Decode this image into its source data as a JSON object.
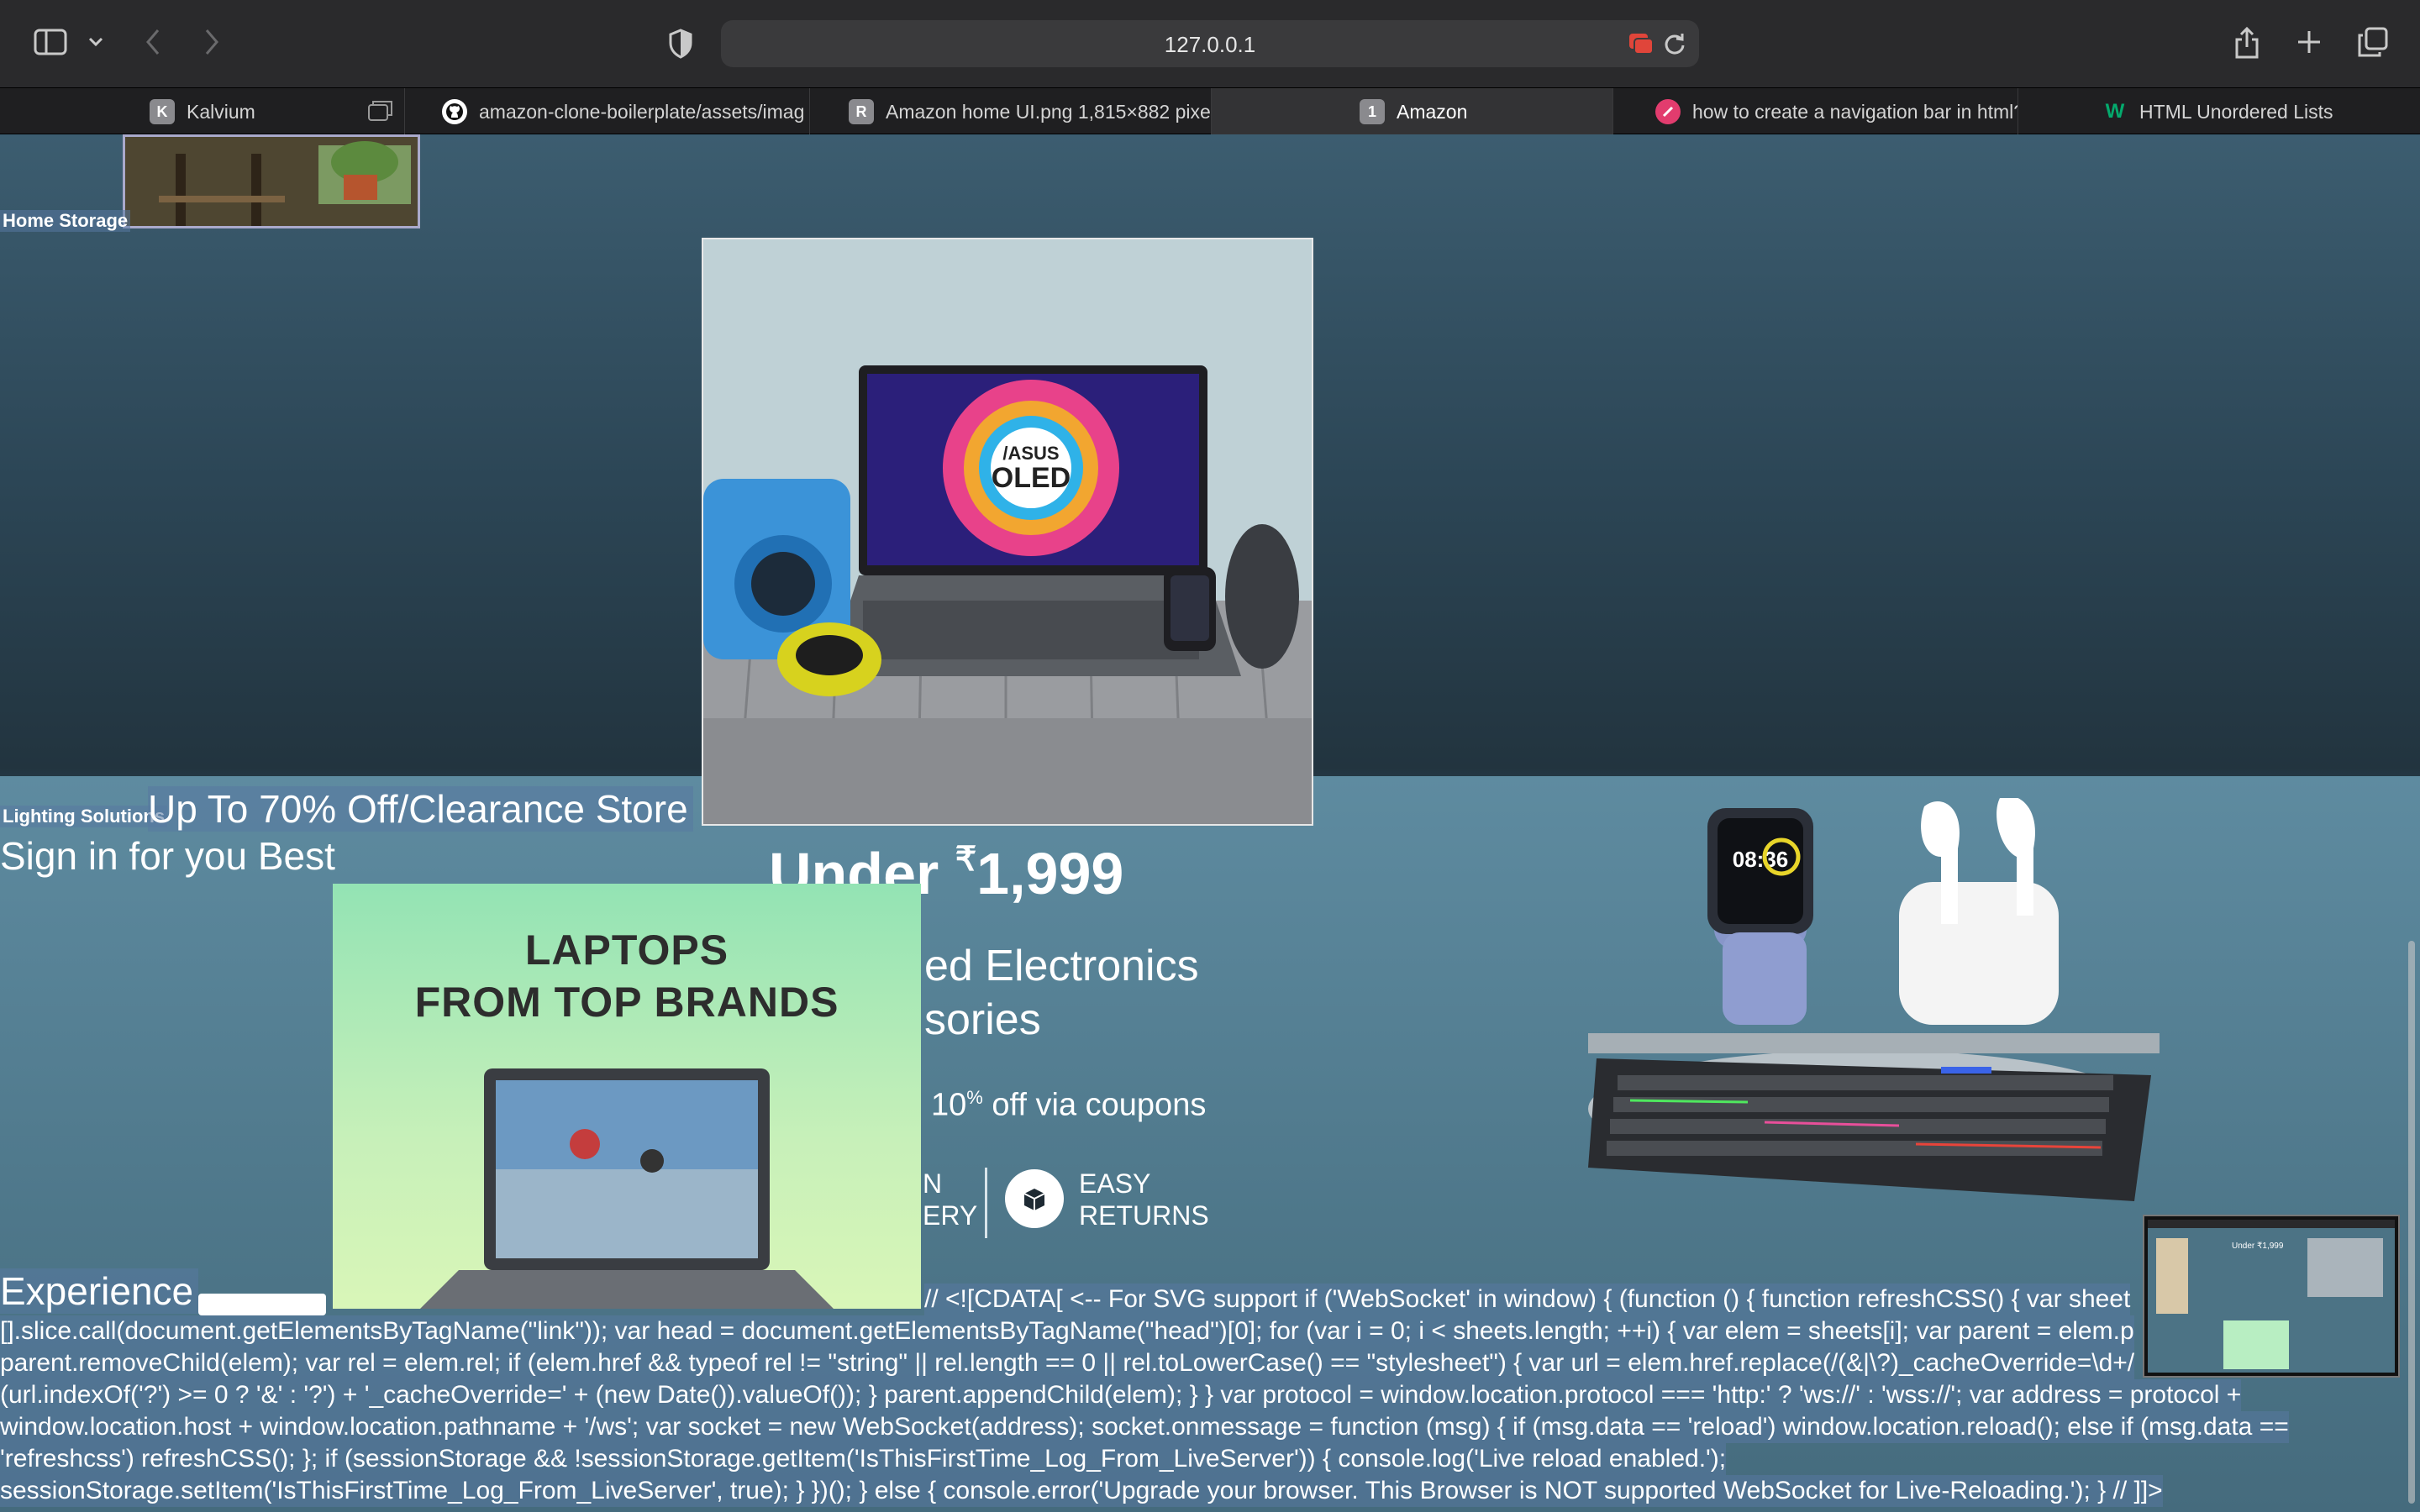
{
  "browser": {
    "url": "127.0.0.1",
    "tabs": [
      {
        "title": "Kalvium",
        "favicon": "K"
      },
      {
        "title": "amazon-clone-boilerplate/assets/imag",
        "favicon": ""
      },
      {
        "title": "Amazon home UI.png 1,815×882 pixe",
        "favicon": "R"
      },
      {
        "title": "Amazon",
        "favicon": "1"
      },
      {
        "title": "how to create a navigation bar in html?",
        "favicon": ""
      },
      {
        "title": "HTML Unordered Lists",
        "favicon": "W"
      }
    ]
  },
  "page": {
    "home_storage": "Home Storage",
    "lighting_solutions": "Lighting Solutions",
    "clearance": "Up To 70% Off/Clearance Store",
    "sign_in": "Sign in for you Best",
    "experience": "Experience",
    "laptops_line1": "LAPTOPS",
    "laptops_line2": "FROM TOP BRANDS",
    "hero_brand": "/ASUS",
    "hero_badge": "OLED",
    "banner_price_prefix": "Under",
    "banner_price_currency": "₹",
    "banner_price": "1,999",
    "banner_line1": "ed Electronics",
    "banner_line2": "sories",
    "banner_coupon_pre": "10",
    "banner_coupon_sup": "%",
    "banner_coupon_post": " off via coupons",
    "banner_delivery_1": "N",
    "banner_delivery_2": "ERY",
    "banner_returns_1": "EASY",
    "banner_returns_2": "RETURNS",
    "watch_time": "08:36",
    "code_lines": [
      "// <![CDATA[ <-- For SVG support if ('WebSocket' in window) { (function () { function refreshCSS() { var sheet",
      "[].slice.call(document.getElementsByTagName(\"link\")); var head = document.getElementsByTagName(\"head\")[0]; for (var i = 0; i < sheets.length; ++i) { var elem = sheets[i]; var parent = elem.p",
      "parent.removeChild(elem); var rel = elem.rel; if (elem.href && typeof rel != \"string\" || rel.length == 0 || rel.toLowerCase() == \"stylesheet\") { var url = elem.href.replace(/(&|\\?)_cacheOverride=\\d+/",
      "(url.indexOf('?') >= 0 ? '&' : '?') + '_cacheOverride=' + (new Date()).valueOf()); } parent.appendChild(elem); } } var protocol = window.location.protocol === 'http:' ? 'ws://' : 'wss://'; var address = protocol +",
      "window.location.host + window.location.pathname + '/ws'; var socket = new WebSocket(address); socket.onmessage = function (msg) { if (msg.data == 'reload') window.location.reload(); else if (msg.data ==",
      "'refreshcss') refreshCSS(); }; if (sessionStorage && !sessionStorage.getItem('IsThisFirstTime_Log_From_LiveServer')) { console.log('Live reload enabled.');",
      "sessionStorage.setItem('IsThisFirstTime_Log_From_LiveServer', true); } })(); } else { console.error('Upgrade your browser. This Browser is NOT supported WebSocket for Live-Reloading.'); } // ]]>"
    ],
    "thumb_text": "Under ₹1,999"
  },
  "colors": {
    "chrome_bg": "#2a2a2c",
    "tabbar_bg": "#1f1f21",
    "selection": "#5878a0",
    "page_top": "#3c5d70",
    "page_band": "#5e8ba0"
  }
}
